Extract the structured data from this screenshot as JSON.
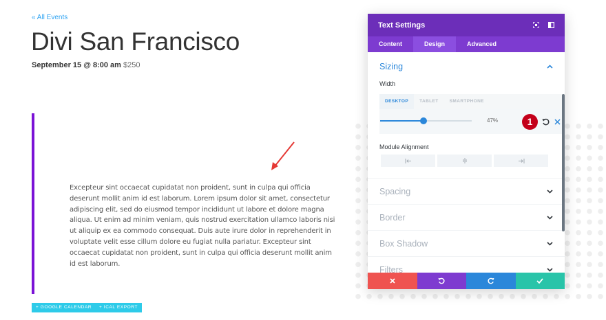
{
  "page": {
    "back_link": "« All Events",
    "title": "Divi San Francisco",
    "date": "September 15 @ 8:00 am",
    "price": "$250",
    "body": "Excepteur sint occaecat cupidatat non proident, sunt in culpa qui officia deserunt mollit anim id est laborum. Lorem ipsum dolor sit amet, consectetur adipiscing elit, sed do eiusmod tempor incididunt ut labore et dolore magna aliqua. Ut enim ad minim veniam, quis nostrud exercitation ullamco laboris nisi ut aliquip ex ea commodo consequat. Duis aute irure dolor in reprehenderit in voluptate velit esse cillum dolore eu fugiat nulla pariatur. Excepteur sint occaecat cupidatat non proident, sunt in culpa qui officia deserunt mollit anim id est laborum.",
    "buttons": [
      "+ GOOGLE CALENDAR",
      "+ ICAL EXPORT"
    ]
  },
  "panel": {
    "title": "Text Settings",
    "tabs": [
      "Content",
      "Design",
      "Advanced"
    ],
    "active_tab": "Design",
    "sizing": {
      "label": "Sizing",
      "width_label": "Width",
      "device_tabs": [
        "DESKTOP",
        "TABLET",
        "SMARTPHONE"
      ],
      "active_device": "DESKTOP",
      "width_value": "47%",
      "width_fraction": 0.47,
      "step_badge": "1",
      "alignment_label": "Module Alignment"
    },
    "sections": [
      "Spacing",
      "Border",
      "Box Shadow",
      "Filters"
    ],
    "colors": {
      "header": "#6c2eb9",
      "tabs": "#7d3bd0",
      "accent": "#2b87da",
      "cancel": "#ef5350",
      "undo": "#7e3bd0",
      "redo": "#2b87da",
      "save": "#29c4a9"
    }
  }
}
